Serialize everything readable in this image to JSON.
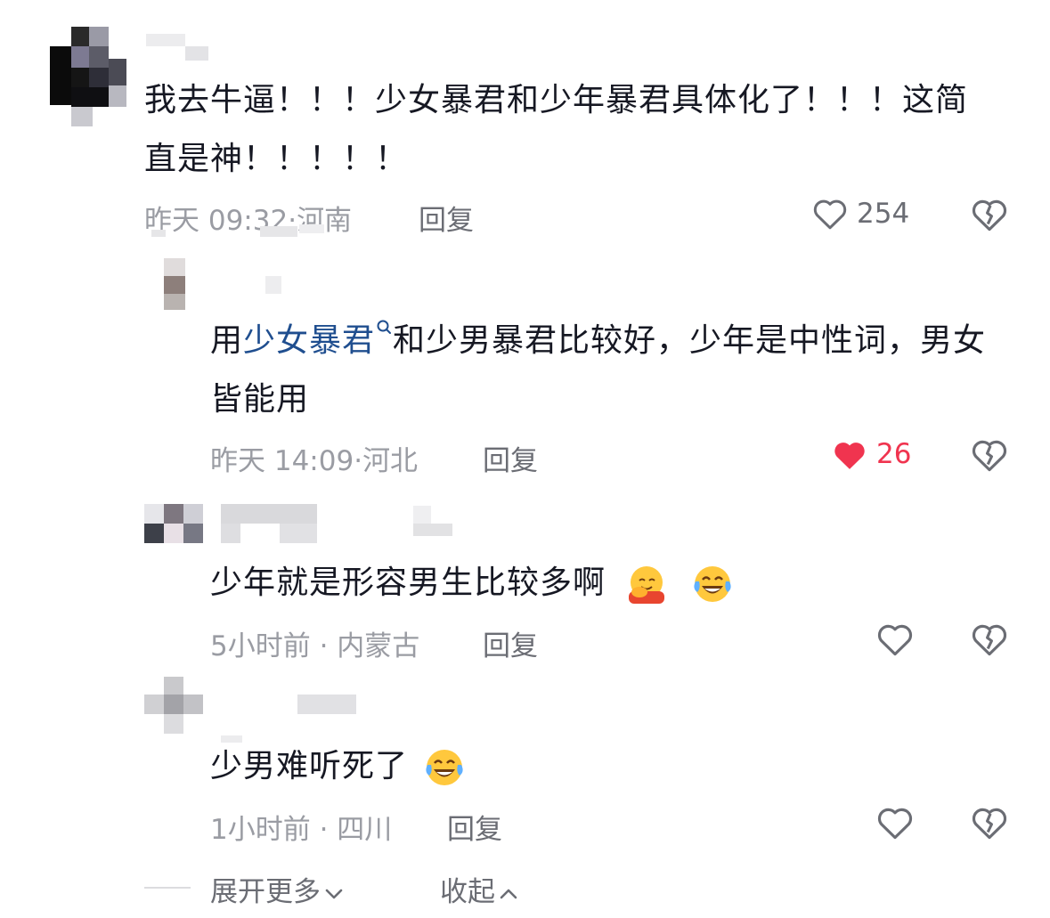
{
  "comments": [
    {
      "text": "我去牛逼！！！少女暴君和少年暴君具体化了！！！这简直是神！！！！！",
      "time": "昨天 09:32",
      "location": "河南",
      "reply_label": "回复",
      "likes": "254",
      "liked": false
    },
    {
      "text_prefix": "用",
      "search_link": "少女暴君",
      "text_suffix": "和少男暴君比较好，少年是中性词，男女皆能用",
      "time": "昨天 14:09",
      "location": "河北",
      "reply_label": "回复",
      "likes": "26",
      "liked": true
    },
    {
      "text": "少年就是形容男生比较多啊",
      "emojis": [
        "hugging-face",
        "tears-of-joy"
      ],
      "time": "5小时前",
      "location": "内蒙古",
      "reply_label": "回复",
      "likes": "",
      "liked": false
    },
    {
      "text": "少男难听死了",
      "emojis": [
        "tears-of-joy"
      ],
      "time": "1小时前",
      "location": "四川",
      "reply_label": "回复",
      "likes": "",
      "liked": false
    }
  ],
  "footer": {
    "expand_label": "展开更多",
    "collapse_label": "收起"
  },
  "colors": {
    "like_active": "#f0344f",
    "link": "#1f4e8f",
    "muted": "#9a9ca3"
  }
}
